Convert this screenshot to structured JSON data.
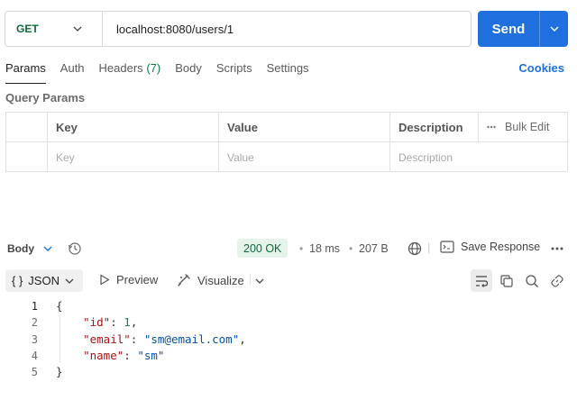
{
  "request": {
    "method": "GET",
    "url": "localhost:8080/users/1",
    "send_label": "Send"
  },
  "tabs": [
    {
      "label": "Params"
    },
    {
      "label": "Auth"
    },
    {
      "label": "Headers",
      "count": "(7)"
    },
    {
      "label": "Body"
    },
    {
      "label": "Scripts"
    },
    {
      "label": "Settings"
    }
  ],
  "cookies_label": "Cookies",
  "query_params": {
    "title": "Query Params",
    "headers": {
      "key": "Key",
      "value": "Value",
      "description": "Description",
      "bulk_edit": "Bulk Edit"
    },
    "placeholders": {
      "key": "Key",
      "value": "Value",
      "description": "Description"
    }
  },
  "response": {
    "body_label": "Body",
    "status": "200 OK",
    "time": "18 ms",
    "size": "207 B",
    "save_label": "Save Response",
    "format": "JSON",
    "preview_label": "Preview",
    "visualize_label": "Visualize",
    "lines": [
      {
        "num": "1",
        "text": "{"
      },
      {
        "num": "2",
        "key": "\"id\"",
        "value": "1",
        "vtype": "number",
        "comma": ","
      },
      {
        "num": "3",
        "key": "\"email\"",
        "value": "\"sm@email.com\"",
        "vtype": "string",
        "comma": ","
      },
      {
        "num": "4",
        "key": "\"name\"",
        "value": "\"sm\"",
        "vtype": "string",
        "comma": ""
      },
      {
        "num": "5",
        "text": "}"
      }
    ]
  },
  "colors": {
    "accent": "#1f6fde",
    "method_get": "#0b6b3a",
    "status_bg": "#e6f3ea"
  }
}
